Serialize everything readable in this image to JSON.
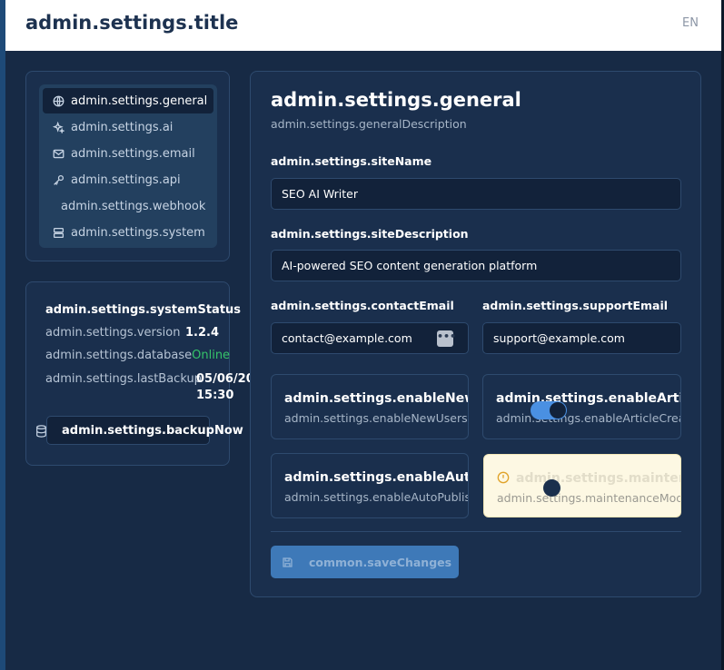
{
  "header": {
    "title": "admin.settings.title",
    "language": "EN"
  },
  "nav": {
    "items": [
      {
        "label": "admin.settings.general",
        "icon": "globe-icon",
        "active": true
      },
      {
        "label": "admin.settings.ai",
        "icon": "sparkles-icon"
      },
      {
        "label": "admin.settings.email",
        "icon": "mail-icon"
      },
      {
        "label": "admin.settings.api",
        "icon": "key-icon"
      },
      {
        "label": "admin.settings.webhook",
        "icon": "webhook-icon"
      },
      {
        "label": "admin.settings.system",
        "icon": "server-icon"
      }
    ]
  },
  "status": {
    "title": "admin.settings.systemStatus",
    "version_label": "admin.settings.version",
    "version_value": "1.2.4",
    "database_label": "admin.settings.database",
    "database_value": "Online",
    "backup_label": "admin.settings.lastBackup",
    "backup_date": "05/06/20",
    "backup_time": "15:30",
    "backup_button": "admin.settings.backupNow"
  },
  "main": {
    "title": "admin.settings.general",
    "description": "admin.settings.generalDescription",
    "siteName": {
      "label": "admin.settings.siteName",
      "value": "SEO AI Writer"
    },
    "siteDescription": {
      "label": "admin.settings.siteDescription",
      "value": "AI-powered SEO content generation platform"
    },
    "contactEmail": {
      "label": "admin.settings.contactEmail",
      "value": "contact@example.com"
    },
    "supportEmail": {
      "label": "admin.settings.supportEmail",
      "value": "support@example.com"
    },
    "toggles": {
      "newUsers": {
        "title": "admin.settings.enableNewUsers",
        "desc": "admin.settings.enableNewUsersDescription"
      },
      "articleCreation": {
        "title": "admin.settings.enableArticleCreation",
        "desc": "admin.settings.enableArticleCreationDescription",
        "on": true
      },
      "autoPublish": {
        "title": "admin.settings.enableAutoPublish",
        "desc": "admin.settings.enableAutoPublishDescription"
      },
      "maintenance": {
        "title": "admin.settings.maintenanceMode",
        "desc": "admin.settings.maintenanceModeDescription"
      }
    },
    "save_button": "common.saveChanges"
  },
  "colors": {
    "accent": "#4a90e2",
    "online": "#35c46a",
    "warning": "#e0a32a"
  }
}
